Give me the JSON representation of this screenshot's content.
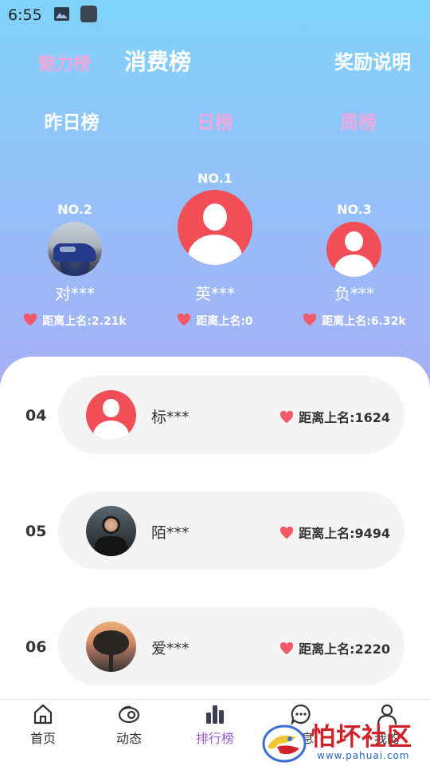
{
  "status_bar": {
    "time": "6:55"
  },
  "top_tabs": {
    "charm": "魅力榜",
    "consume": "消费榜",
    "reward": "奖励说明"
  },
  "period_tabs": {
    "yesterday": "昨日榜",
    "day": "日榜",
    "week": "周榜"
  },
  "podium": [
    {
      "rank": "NO.1",
      "name": "英***",
      "gap": "距离上名:0"
    },
    {
      "rank": "NO.2",
      "name": "对***",
      "gap": "距离上名:2.21k"
    },
    {
      "rank": "NO.3",
      "name": "负***",
      "gap": "距离上名:6.32k"
    }
  ],
  "list": [
    {
      "rank": "04",
      "name": "标***",
      "gap": "距离上名:1624"
    },
    {
      "rank": "05",
      "name": "陌***",
      "gap": "距离上名:9494"
    },
    {
      "rank": "06",
      "name": "爱***",
      "gap": "距离上名:2220"
    }
  ],
  "nav": [
    {
      "label": "首页",
      "icon": "home-icon"
    },
    {
      "label": "动态",
      "icon": "moments-icon"
    },
    {
      "label": "排行榜",
      "icon": "ranking-icon"
    },
    {
      "label": "消息",
      "icon": "message-icon"
    },
    {
      "label": "我的",
      "icon": "profile-icon"
    }
  ],
  "watermark": {
    "text": "怕坏社区",
    "url": "www.pahuai.com"
  },
  "colors": {
    "heart": "#f25a6a",
    "active_nav": "#9a5cd8",
    "inactive_tab": "#f0a8de",
    "default_avatar": "#f24e58"
  }
}
